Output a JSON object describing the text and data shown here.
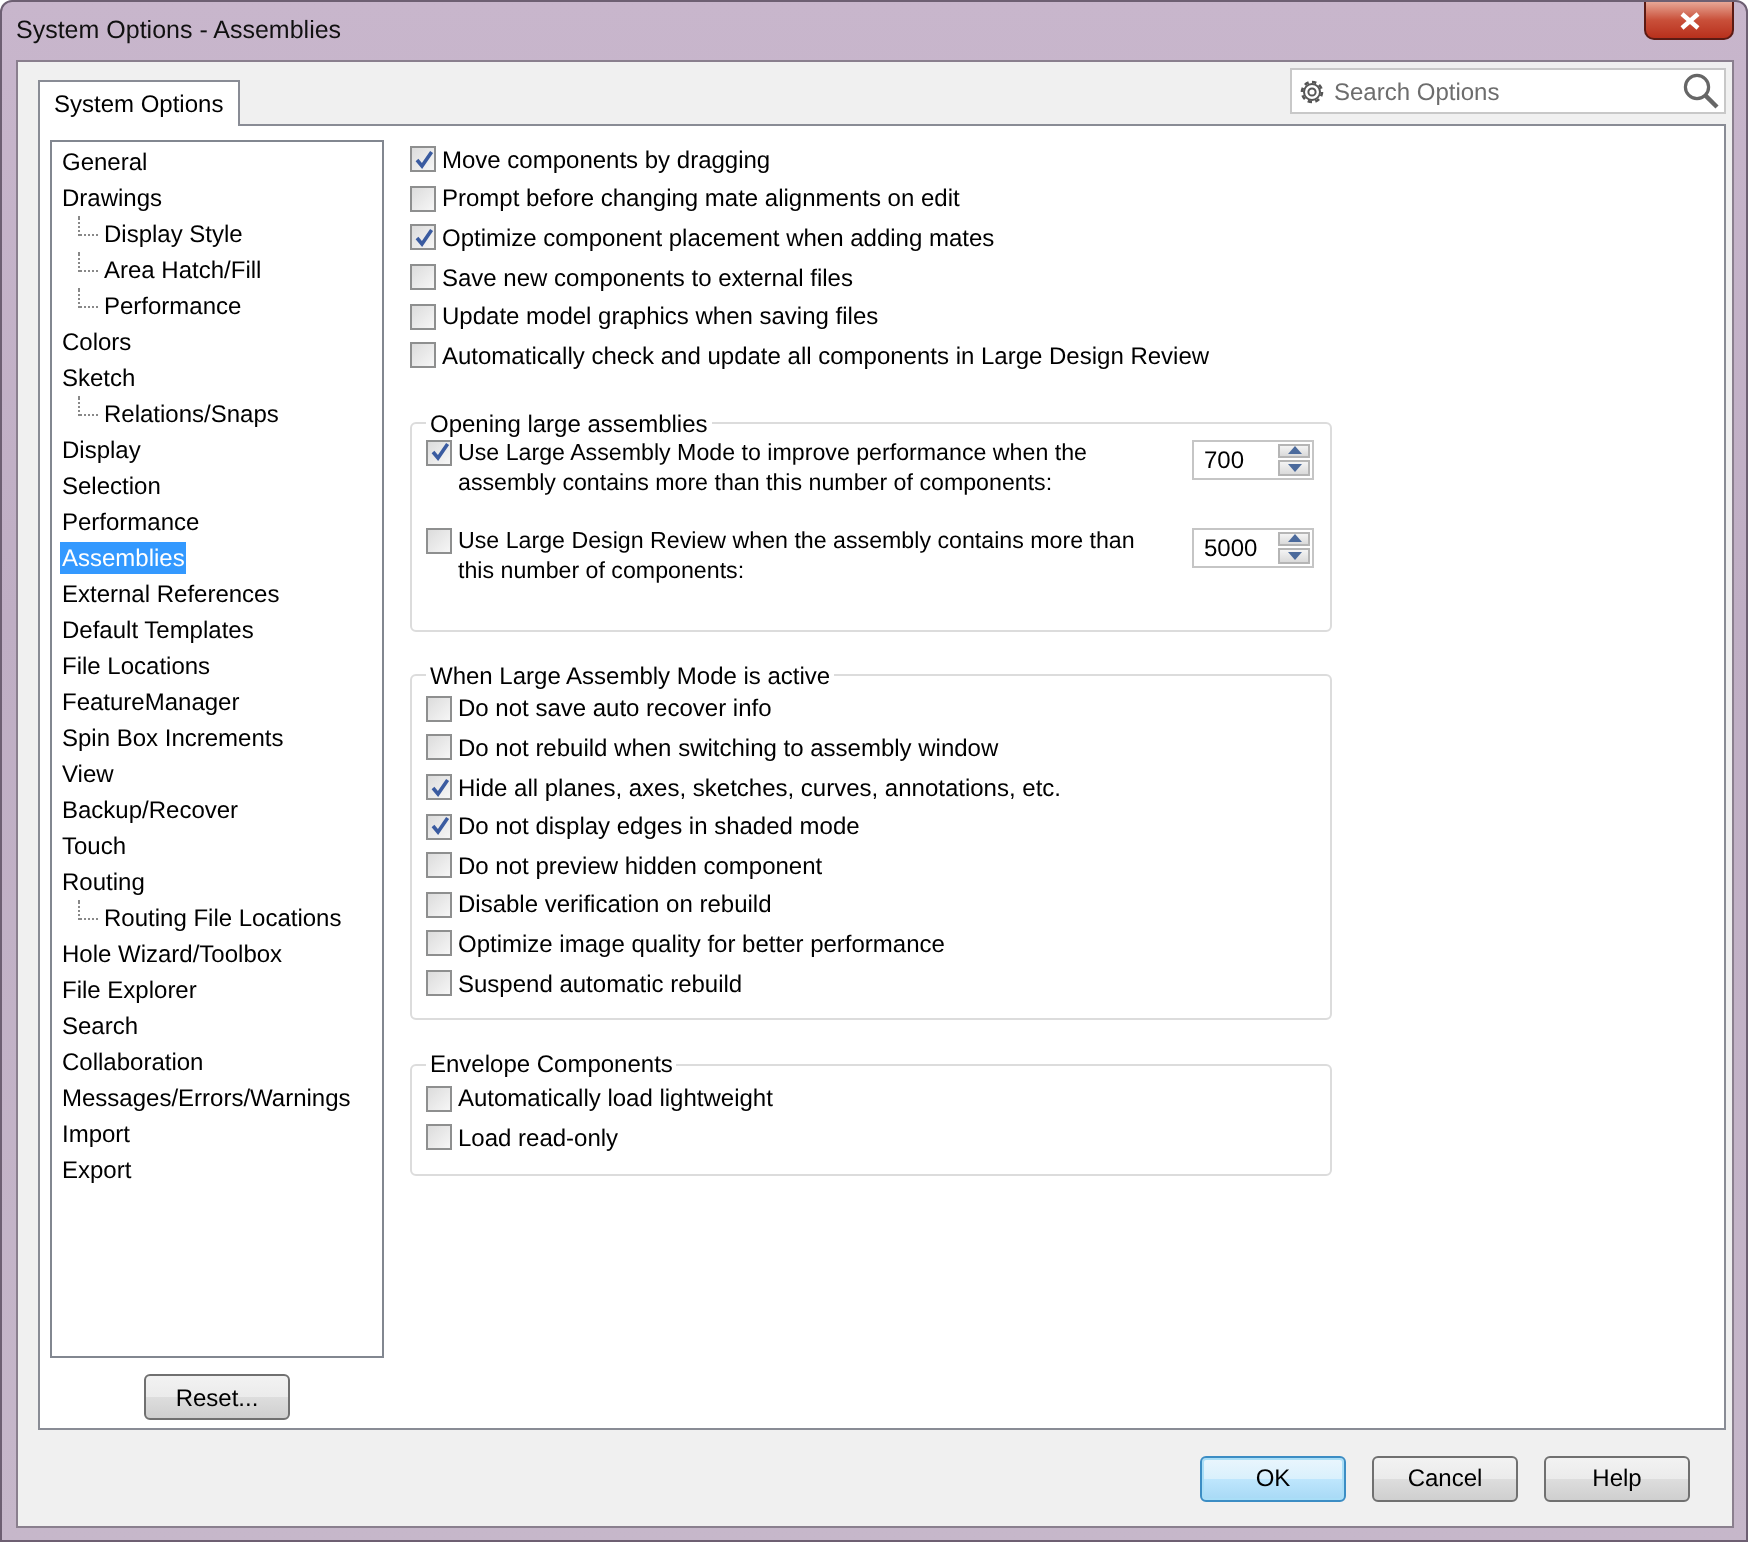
{
  "window": {
    "title": "System Options - Assemblies"
  },
  "tabs": [
    {
      "label": "System Options",
      "selected": true
    }
  ],
  "search": {
    "placeholder": "Search Options"
  },
  "sidebar": {
    "items": [
      {
        "label": "General",
        "selected": false
      },
      {
        "label": "Drawings",
        "selected": false,
        "children": [
          {
            "label": "Display Style",
            "selected": false
          },
          {
            "label": "Area Hatch/Fill",
            "selected": false
          },
          {
            "label": "Performance",
            "selected": false
          }
        ]
      },
      {
        "label": "Colors",
        "selected": false
      },
      {
        "label": "Sketch",
        "selected": false,
        "children": [
          {
            "label": "Relations/Snaps",
            "selected": false
          }
        ]
      },
      {
        "label": "Display",
        "selected": false
      },
      {
        "label": "Selection",
        "selected": false
      },
      {
        "label": "Performance",
        "selected": false
      },
      {
        "label": "Assemblies",
        "selected": true
      },
      {
        "label": "External References",
        "selected": false
      },
      {
        "label": "Default Templates",
        "selected": false
      },
      {
        "label": "File Locations",
        "selected": false
      },
      {
        "label": "FeatureManager",
        "selected": false
      },
      {
        "label": "Spin Box Increments",
        "selected": false
      },
      {
        "label": "View",
        "selected": false
      },
      {
        "label": "Backup/Recover",
        "selected": false
      },
      {
        "label": "Touch",
        "selected": false
      },
      {
        "label": "Routing",
        "selected": false,
        "children": [
          {
            "label": "Routing File Locations",
            "selected": false
          }
        ]
      },
      {
        "label": "Hole Wizard/Toolbox",
        "selected": false
      },
      {
        "label": "File Explorer",
        "selected": false
      },
      {
        "label": "Search",
        "selected": false
      },
      {
        "label": "Collaboration",
        "selected": false
      },
      {
        "label": "Messages/Errors/Warnings",
        "selected": false
      },
      {
        "label": "Import",
        "selected": false
      },
      {
        "label": "Export",
        "selected": false
      }
    ]
  },
  "reset_button": "Reset...",
  "options": [
    {
      "label": "Move components by dragging",
      "checked": true
    },
    {
      "label": "Prompt before changing mate alignments on edit",
      "checked": false
    },
    {
      "label": "Optimize component placement when adding mates",
      "checked": true
    },
    {
      "label": "Save new components to external files",
      "checked": false
    },
    {
      "label": "Update model graphics when saving files",
      "checked": false
    },
    {
      "label": "Automatically check and update all components in Large Design Review",
      "checked": false
    }
  ],
  "groups": [
    {
      "title": "Opening large assemblies",
      "items": [
        {
          "kind": "spin",
          "label": "Use Large Assembly Mode to improve performance when the assembly contains more than this number of components:",
          "checked": true,
          "value": "700"
        },
        {
          "kind": "spin",
          "label": "Use Large Design Review when the assembly contains more than this number of components:",
          "checked": false,
          "value": "5000"
        }
      ]
    },
    {
      "title": "When Large Assembly Mode is active",
      "items": [
        {
          "kind": "checkbox",
          "label": "Do not save auto recover info",
          "checked": false
        },
        {
          "kind": "checkbox",
          "label": "Do not rebuild when switching to assembly window",
          "checked": false
        },
        {
          "kind": "checkbox",
          "label": "Hide all planes, axes, sketches, curves, annotations, etc.",
          "checked": true
        },
        {
          "kind": "checkbox",
          "label": "Do not display edges in shaded mode",
          "checked": true
        },
        {
          "kind": "checkbox",
          "label": "Do not preview hidden component",
          "checked": false
        },
        {
          "kind": "checkbox",
          "label": "Disable verification on rebuild",
          "checked": false
        },
        {
          "kind": "checkbox",
          "label": "Optimize image quality for better performance",
          "checked": false
        },
        {
          "kind": "checkbox",
          "label": "Suspend automatic rebuild",
          "checked": false
        }
      ]
    },
    {
      "title": "Envelope Components",
      "items": [
        {
          "kind": "checkbox",
          "label": "Automatically load lightweight",
          "checked": false
        },
        {
          "kind": "checkbox",
          "label": "Load read-only",
          "checked": false
        }
      ]
    }
  ],
  "buttons": [
    {
      "label": "OK",
      "default": true
    },
    {
      "label": "Cancel",
      "default": false
    },
    {
      "label": "Help",
      "default": false
    }
  ]
}
